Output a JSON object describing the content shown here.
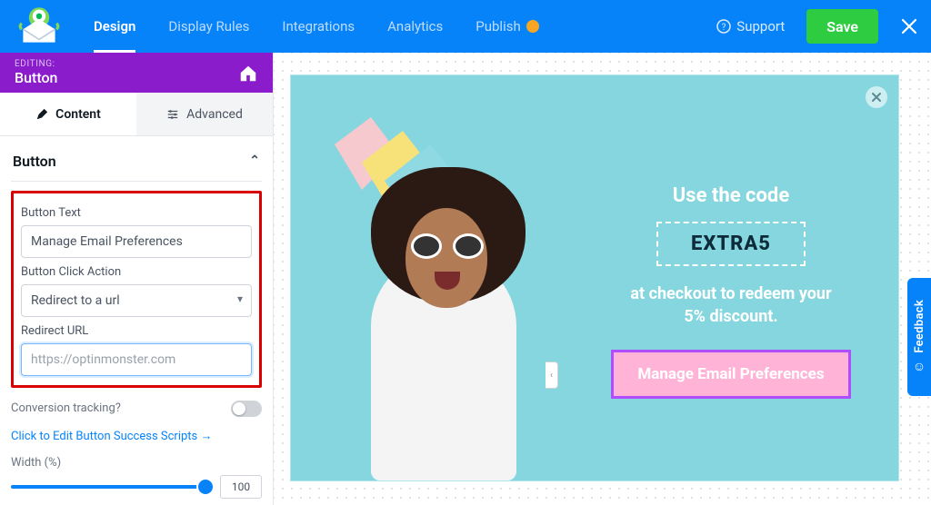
{
  "topnav": {
    "tabs": [
      "Design",
      "Display Rules",
      "Integrations",
      "Analytics",
      "Publish"
    ],
    "active_index": 0,
    "support_label": "Support",
    "save_label": "Save"
  },
  "editing_header": {
    "small": "EDITING:",
    "title": "Button"
  },
  "side_tabs": {
    "content": "Content",
    "advanced": "Advanced",
    "active": "content"
  },
  "panel": {
    "section_title": "Button",
    "button_text_label": "Button Text",
    "button_text_value": "Manage Email Preferences",
    "click_action_label": "Button Click Action",
    "click_action_value": "Redirect to a url",
    "redirect_url_label": "Redirect URL",
    "redirect_url_placeholder": "https://optinmonster.com",
    "redirect_url_value": "",
    "conversion_label": "Conversion tracking?",
    "conversion_on": false,
    "success_scripts_link": "Click to Edit Button Success Scripts →",
    "width_label": "Width (%)",
    "width_value": "100"
  },
  "campaign": {
    "headline_lead": "Use the code",
    "coupon_code": "EXTRA5",
    "sub_line1": "at checkout to redeem your",
    "sub_line2": "5% discount.",
    "cta_label": "Manage Email Preferences"
  },
  "feedback": {
    "label": "Feedback"
  },
  "colors": {
    "primary": "#0683f9",
    "success": "#2ecc40",
    "purple": "#8a1ccc",
    "campaign_bg": "#85d6de",
    "cta_bg": "#ffb3d7",
    "cta_border": "#b04dff",
    "highlight_border": "#d80000"
  }
}
